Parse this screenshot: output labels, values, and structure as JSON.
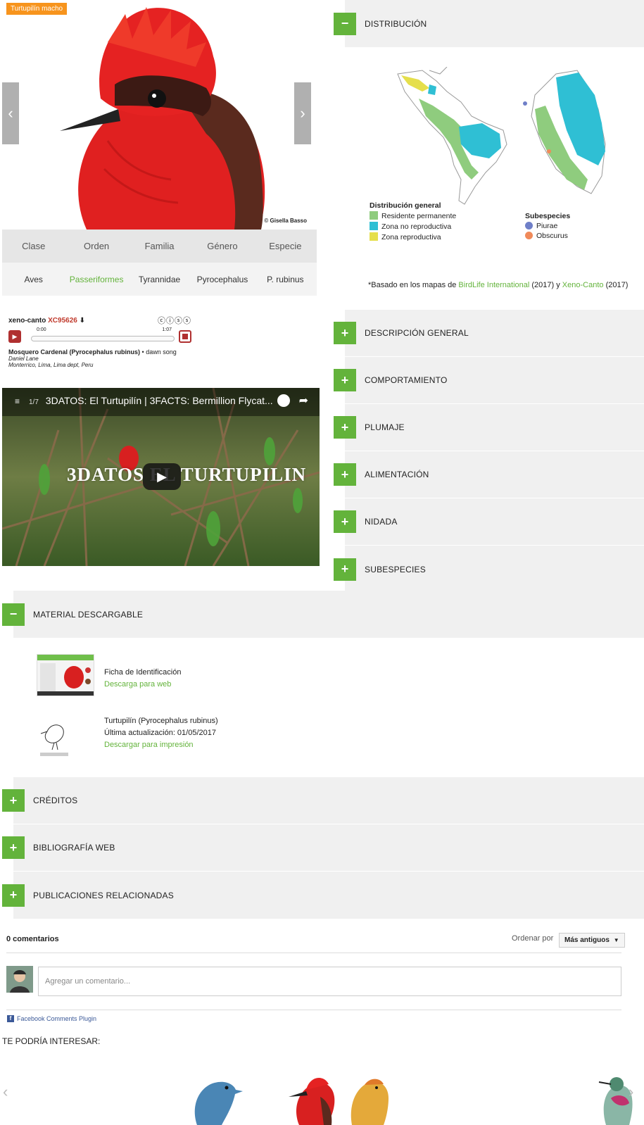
{
  "hero": {
    "tag": "Turtupilín macho",
    "credit": "© Gisella Basso",
    "prev_icon": "chevron-left-icon",
    "next_icon": "chevron-right-icon"
  },
  "taxonomy": {
    "headers": [
      "Clase",
      "Orden",
      "Familia",
      "Género",
      "Especie"
    ],
    "values": [
      "Aves",
      "Passeriformes",
      "Tyrannidae",
      "Pyrocephalus",
      "P. rubinus"
    ]
  },
  "audio": {
    "brand": "xeno-canto",
    "id": "XC95626",
    "time_start": "0:00",
    "time_end": "1:07",
    "title": "Mosquero Cardenal (Pyrocephalus rubinus)",
    "type": "dawn song",
    "recordist": "Daniel Lane",
    "location": "Monterrico, Lima, Lima dept, Peru"
  },
  "video": {
    "counter": "1/7",
    "title": "3DATOS: El Turtupilín | 3FACTS: Bermillion Flycat...",
    "overlay": "3DATOS EL TURTUPILIN"
  },
  "distribution": {
    "label": "DISTRIBUCIÓN",
    "legend_title": "Distribución general",
    "legend": [
      {
        "label": "Residente permanente",
        "color": "#8fcc7e"
      },
      {
        "label": "Zona no reproductiva",
        "color": "#2fbfd4"
      },
      {
        "label": "Zona reproductiva",
        "color": "#e5df4c"
      }
    ],
    "sub_title": "Subespecies",
    "subspecies": [
      {
        "label": "Piurae",
        "color": "#6f7fc8"
      },
      {
        "label": "Obscurus",
        "color": "#f08a5a"
      }
    ],
    "note_prefix": "*Basado en los mapas de ",
    "note_link1": "BirdLife International",
    "note_mid": " (2017) y ",
    "note_link2": "Xeno-Canto",
    "note_suffix": " (2017)"
  },
  "right_sections": [
    "DESCRIPCIÓN GENERAL",
    "COMPORTAMIENTO",
    "PLUMAJE",
    "ALIMENTACIÓN",
    "NIDADA",
    "SUBESPECIES"
  ],
  "material": {
    "label": "MATERIAL DESCARGABLE",
    "item1": {
      "title": "Ficha de Identificación",
      "link": "Descarga para web"
    },
    "item2": {
      "title": "Turtupilín (Pyrocephalus rubinus)",
      "updated": "Última actualización: 01/05/2017",
      "link": "Descargar para impresión"
    }
  },
  "bottom_sections": [
    "CRÉDITOS",
    "BIBLIOGRAFÍA WEB",
    "PUBLICACIONES RELACIONADAS"
  ],
  "comments": {
    "count": "0 comentarios",
    "sort_label": "Ordenar por",
    "sort_value": "Más antiguos",
    "placeholder": "Agregar un comentario...",
    "plugin": "Facebook Comments Plugin"
  },
  "related": {
    "title": "TE PODRÍA INTERESAR:"
  },
  "colors": {
    "accent": "#63b33b",
    "tag": "#f7941d",
    "panel": "#f0f0f0"
  }
}
